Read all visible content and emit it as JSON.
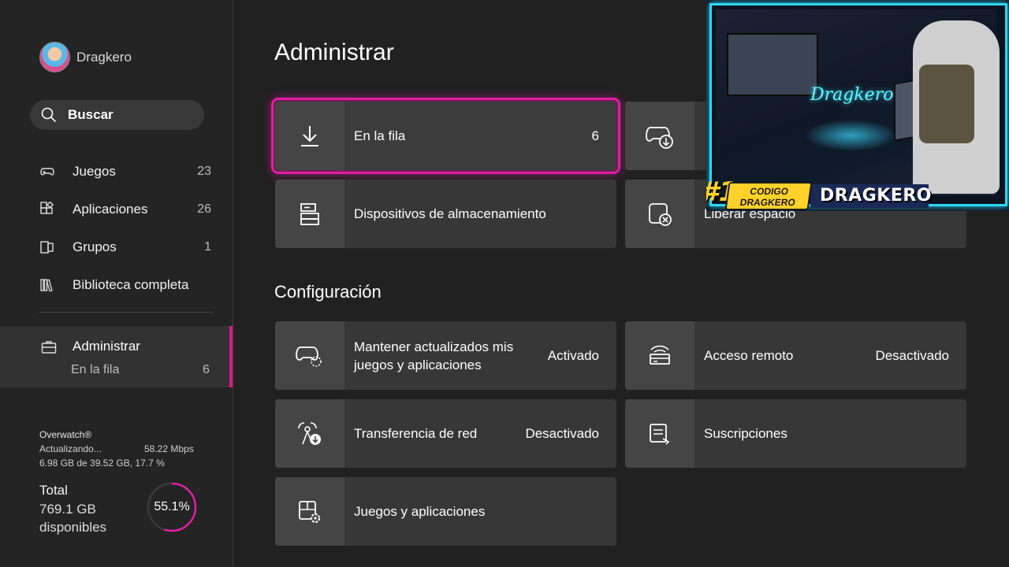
{
  "sidebar": {
    "profile_name": "Dragkero",
    "search_label": "Buscar",
    "nav": [
      {
        "label": "Juegos",
        "count": "23",
        "icon": "gamepad-icon"
      },
      {
        "label": "Aplicaciones",
        "count": "26",
        "icon": "apps-icon"
      },
      {
        "label": "Grupos",
        "count": "1",
        "icon": "groups-icon"
      },
      {
        "label": "Biblioteca completa",
        "count": "",
        "icon": "library-icon"
      }
    ],
    "admin": {
      "label": "Administrar",
      "sub_label": "En la fila",
      "sub_count": "6"
    },
    "download": {
      "game": "Overwatch®",
      "status": "Actualizando...",
      "speed": "58.22 Mbps",
      "progress": "6.98 GB de 39.52 GB, 17.7 %"
    },
    "storage": {
      "title": "Total",
      "size": "769.1 GB",
      "free_label": "disponibles",
      "percent_label": "55.1%",
      "percent_value": 55.1
    }
  },
  "main": {
    "title": "Administrar",
    "tiles": [
      {
        "label": "En la fila",
        "value": "6"
      },
      {
        "label": "",
        "value": ""
      },
      {
        "label": "Dispositivos de almacenamiento",
        "value": ""
      },
      {
        "label": "Liberar espacio",
        "value": ""
      }
    ],
    "settings_title": "Configuración",
    "settings": [
      {
        "label_line1": "Mantener actualizados mis",
        "label_line2": "juegos y aplicaciones",
        "value": "Activado"
      },
      {
        "label": "Acceso remoto",
        "value": "Desactivado"
      },
      {
        "label": "Transferencia de red",
        "value": "Desactivado"
      },
      {
        "label": "Suscripciones",
        "value": ""
      },
      {
        "label": "Juegos y aplicaciones",
        "value": ""
      }
    ]
  },
  "overlay": {
    "badge_number": "#1",
    "badge_code_line1": "CODIGO",
    "badge_code_line2": "DRAGKERO",
    "badge_name": "DRAGKERO",
    "neon_sign": "Dragkero",
    "accent": "#2fd6f0"
  },
  "colors": {
    "accent": "#e01fa0",
    "background": "#212121",
    "tile": "#373737"
  }
}
